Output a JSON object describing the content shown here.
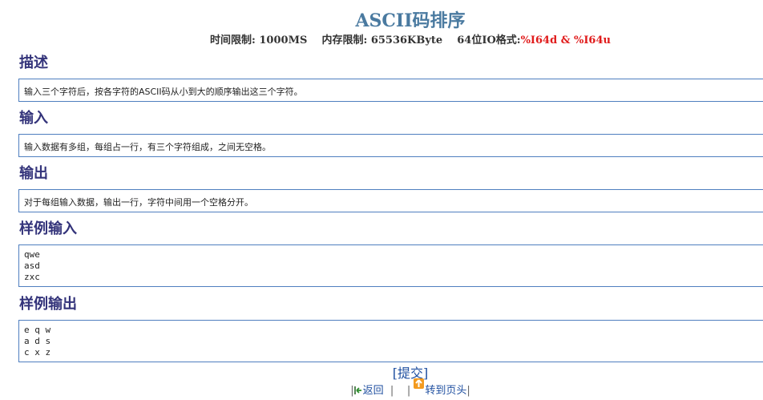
{
  "problem": {
    "title": "ASCII码排序",
    "limits": {
      "time_label": "时间限制:",
      "time_value": "1000MS",
      "memory_label": "内存限制:",
      "memory_value": "65536KByte",
      "io_label": "64位IO格式:",
      "io_value": "%I64d & %I64u"
    }
  },
  "sections": {
    "description": {
      "heading": "描述",
      "content": "输入三个字符后，按各字符的ASCII码从小到大的顺序输出这三个字符。"
    },
    "input": {
      "heading": "输入",
      "content": "输入数据有多组，每组占一行，有三个字符组成，之间无空格。"
    },
    "output": {
      "heading": "输出",
      "content": "对于每组输入数据，输出一行，字符中间用一个空格分开。"
    },
    "sample_input": {
      "heading": "样例输入",
      "content": "qwe\nasd\nzxc"
    },
    "sample_output": {
      "heading": "样例输出",
      "content": "e q w\na d s\nc x z"
    }
  },
  "footer": {
    "submit_open": "[",
    "submit_label": "提交",
    "submit_close": "]",
    "sep_left": "|",
    "back_label": "返回",
    "sep_mid": "|",
    "sep_mid2": "|",
    "top_label": "转到页头",
    "sep_right": "|",
    "icons": {
      "back": "back-arrow-icon",
      "top": "up-arrow-icon"
    },
    "colors": {
      "link": "#1f4fa0",
      "accent_title": "#4a7aa0",
      "io_red": "#e01b1b",
      "heading": "#33337a",
      "box_border": "#4f7fbf"
    }
  }
}
